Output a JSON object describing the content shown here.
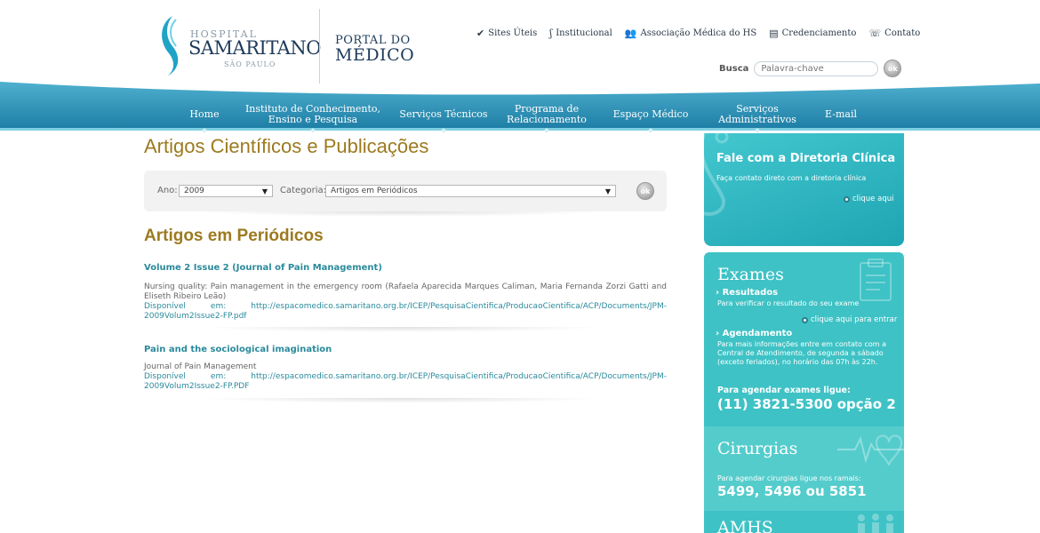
{
  "header": {
    "logo": {
      "hospital": "HOSPITAL",
      "name": "SAMARITANO",
      "city": "SÃO PAULO"
    },
    "portal": {
      "line1": "PORTAL DO",
      "line2": "MÉDICO"
    },
    "top_links": [
      {
        "label": "Sites Úteis",
        "icon": "chevron-down-icon"
      },
      {
        "label": "Institucional",
        "icon": "swoosh-icon"
      },
      {
        "label": "Associação Médica do HS",
        "icon": "people-icon"
      },
      {
        "label": "Credenciamento",
        "icon": "id-card-icon"
      },
      {
        "label": "Contato",
        "icon": "phone-icon"
      }
    ],
    "search": {
      "label": "Busca",
      "placeholder": "Palavra-chave",
      "button": "ok"
    }
  },
  "nav": {
    "items": [
      {
        "label": "Home"
      },
      {
        "label": "Instituto de Conhecimento, Ensino e Pesquisa"
      },
      {
        "label": "Serviços Técnicos"
      },
      {
        "label": "Programa de Relacionamento"
      },
      {
        "label": "Espaço Médico"
      },
      {
        "label": "Serviços Administrativos"
      },
      {
        "label": "E-mail"
      }
    ]
  },
  "main": {
    "title": "Artigos Científicos e Publicações",
    "filters": {
      "ano_label": "Ano:",
      "ano_value": "2009",
      "categoria_label": "Categoria:",
      "categoria_value": "Artigos em Periódicos",
      "button": "ok"
    },
    "section_title": "Artigos em Periódicos",
    "articles": [
      {
        "title": "Volume 2 Issue 2 (Journal of Pain Management)",
        "description": "Nursing quality: Pain management in the emergency room (Rafaela Aparecida Marques Caliman, Maria Fernanda Zorzi Gatti and Eliseth Ribeiro Leão)",
        "link": "Disponível em: http://espacomedico.samaritano.org.br/ICEP/PesquisaCientifica/ProducaoCientifica/ACP/Documents/JPM-2009Volum2Issue2-FP.pdf"
      },
      {
        "title": "Pain and the sociological imagination",
        "description": "Journal of Pain Management",
        "link": "Disponível em: http://espacomedico.samaritano.org.br/ICEP/PesquisaCientifica/ProducaoCientifica/ACP/Documents/JPM-2009Volum2Issue2-FP.PDF"
      }
    ]
  },
  "sidebar": {
    "diretoria": {
      "title": "Fale com a Diretoria Clínica",
      "subtitle": "Faça contato direto com a diretoria clínica",
      "link": "clique aqui"
    },
    "exames": {
      "title": "Exames",
      "resultados_title": "› Resultados",
      "resultados_text": "Para verificar o resultado do seu exame",
      "resultados_link": "clique aqui para entrar",
      "agendamento_title": "› Agendamento",
      "agendamento_text": "Para mais informações entre em contato com a Central de Atendimento, de segunda a sábado (exceto feriados), no horário das 07h às 22h.",
      "phone_label": "Para agendar exames ligue:",
      "phone": "(11) 3821-5300 opção 2"
    },
    "cirurgias": {
      "title": "Cirurgias",
      "text": "Para agendar cirurgias ligue nos ramais:",
      "ramais": "5499, 5496 ou 5851"
    },
    "amhs": {
      "title": "AMHS"
    }
  },
  "colors": {
    "accent_gold": "#9c7a1f",
    "link_teal": "#2a8a9c",
    "nav_blue": "#2a8db0",
    "sidebar_teal": "#3ec2c5"
  }
}
